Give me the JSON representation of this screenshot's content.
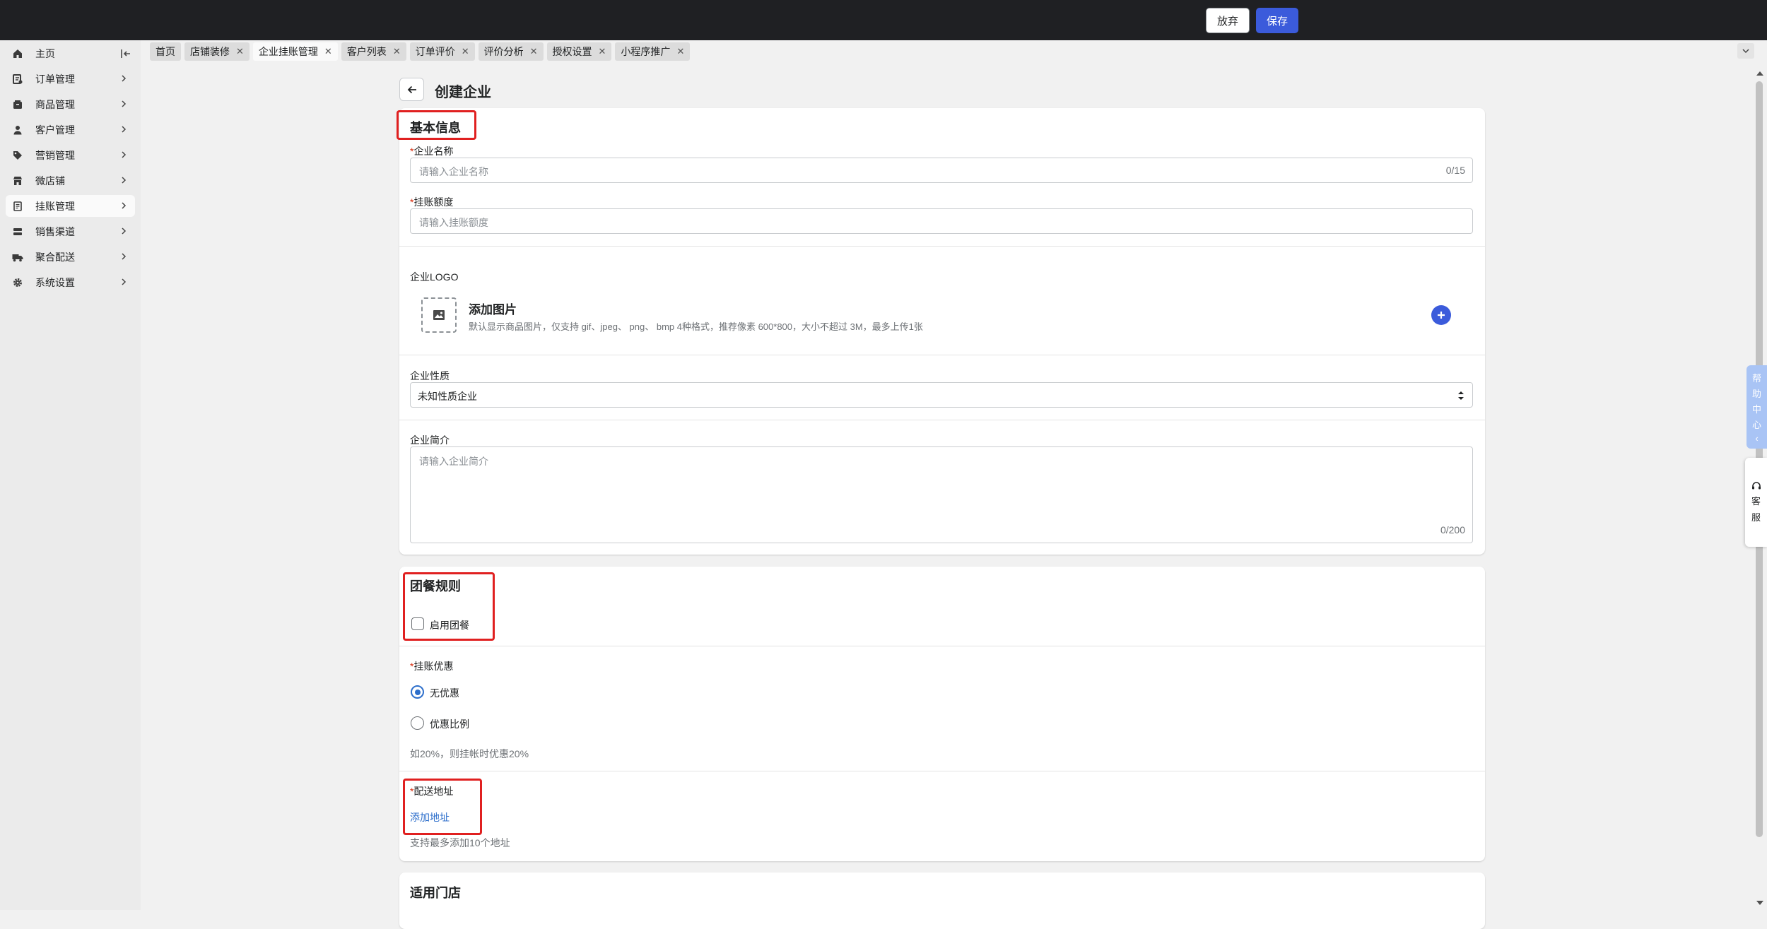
{
  "topbar": {
    "discard_label": "放弃",
    "save_label": "保存"
  },
  "sidebar": {
    "items": [
      {
        "label": "主页",
        "icon": "home-icon"
      },
      {
        "label": "订单管理",
        "icon": "order-icon"
      },
      {
        "label": "商品管理",
        "icon": "product-icon"
      },
      {
        "label": "客户管理",
        "icon": "person-icon"
      },
      {
        "label": "营销管理",
        "icon": "tag-icon"
      },
      {
        "label": "微店铺",
        "icon": "store-icon"
      },
      {
        "label": "挂账管理",
        "icon": "receipt-icon",
        "active": true
      },
      {
        "label": "销售渠道",
        "icon": "channel-icon"
      },
      {
        "label": "聚合配送",
        "icon": "truck-icon"
      },
      {
        "label": "系统设置",
        "icon": "gear-icon"
      }
    ]
  },
  "tabs": [
    {
      "label": "首页"
    },
    {
      "label": "店铺装修"
    },
    {
      "label": "企业挂账管理",
      "active": true
    },
    {
      "label": "客户列表"
    },
    {
      "label": "订单评价"
    },
    {
      "label": "评价分析"
    },
    {
      "label": "授权设置"
    },
    {
      "label": "小程序推广"
    }
  ],
  "page": {
    "title": "创建企业"
  },
  "basic": {
    "title": "基本信息",
    "name_label": "企业名称",
    "name_placeholder": "请输入企业名称",
    "name_count": "0/15",
    "credit_label": "挂账额度",
    "credit_placeholder": "请输入挂账额度",
    "logo_label": "企业LOGO",
    "upload_title": "添加图片",
    "upload_hint": "默认显示商品图片，仅支持 gif、jpeg、 png、 bmp 4种格式，推荐像素 600*800，大小不超过 3M，最多上传1张",
    "nature_label": "企业性质",
    "nature_value": "未知性质企业",
    "intro_label": "企业简介",
    "intro_placeholder": "请输入企业简介",
    "intro_count": "0/200"
  },
  "group": {
    "title": "团餐规则",
    "enable_label": "启用团餐",
    "discount_label": "挂账优惠",
    "opt_none": "无优惠",
    "opt_ratio": "优惠比例",
    "discount_hint": "如20%，则挂帐时优惠20%",
    "address_label": "配送地址",
    "add_address": "添加地址",
    "address_hint": "支持最多添加10个地址"
  },
  "stores": {
    "title": "适用门店"
  },
  "float": {
    "help_chars": [
      "帮",
      "助",
      "中",
      "心",
      "‹"
    ],
    "cs_chars": [
      "客",
      "服"
    ]
  },
  "colors": {
    "primary": "#3b5bdb",
    "link": "#2c6ecb",
    "highlight": "#e02020",
    "topbar": "#1f2023"
  }
}
